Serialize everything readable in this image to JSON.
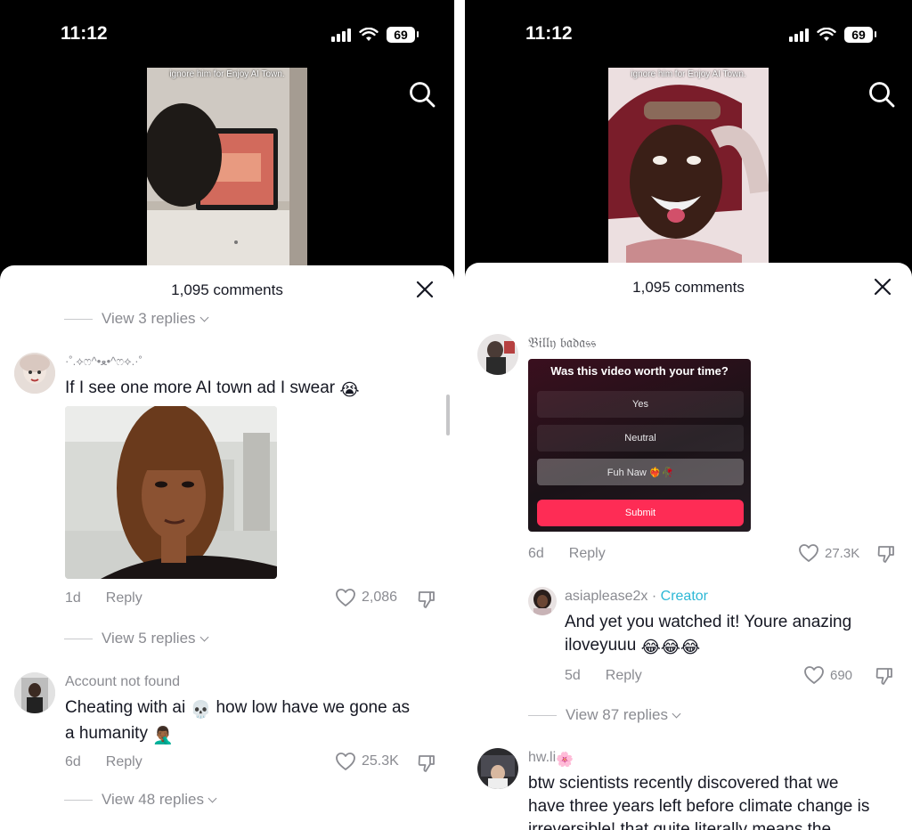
{
  "status_bar": {
    "time": "11:12",
    "battery": "69"
  },
  "video_caption": "ignore him for Enjoy AI Town.",
  "left": {
    "comment_count": "1,095 comments",
    "top_view_replies": "View 3 replies",
    "comments": [
      {
        "username": "·˚.⟡ෆ^•ﻌ•^ෆ⟡.·˚",
        "text": "If I see one more AI town ad I swear",
        "emoji": "😭",
        "age": "1d",
        "reply_label": "Reply",
        "likes": "2,086",
        "view_replies": "View 5 replies"
      },
      {
        "username": "Account not found",
        "text_line1": "Cheating with ai",
        "emoji1": "💀",
        "text_line1b": "how low have we gone as",
        "text_line2": "a humanity",
        "emoji2": "🤦🏾‍♂️",
        "age": "6d",
        "reply_label": "Reply",
        "likes": "25.3K",
        "view_replies": "View 48 replies"
      }
    ]
  },
  "right": {
    "comment_count": "1,095 comments",
    "comments": [
      {
        "username": "𝔅𝔦𝔩𝔩𝔶 𝔟𝔞𝔡𝔞𝔰𝔰",
        "poll": {
          "question": "Was this video worth your time?",
          "options": [
            "Yes",
            "Neutral",
            "Fuh Naw ❤️‍🔥🥀"
          ],
          "submit": "Submit"
        },
        "age": "6d",
        "reply_label": "Reply",
        "likes": "27.3K"
      },
      {
        "username": "asiaplease2x",
        "badge": "Creator",
        "text_line1": "And yet you watched it! Youre anazing",
        "text_line2": "iloveyuuu",
        "emoji": "😂😂😂",
        "age": "5d",
        "reply_label": "Reply",
        "likes": "690",
        "view_replies": "View 87 replies"
      },
      {
        "username": "hw.li",
        "username_emoji": "🌸",
        "text_line1": "btw scientists recently discovered that we",
        "text_line2": "have three years left before climate change is",
        "text_line3": "irreversible! that quite literally means the"
      }
    ]
  },
  "colors": {
    "submit": "#fe2c55",
    "creator": "#2db8d6",
    "muted": "#8a8b91"
  }
}
